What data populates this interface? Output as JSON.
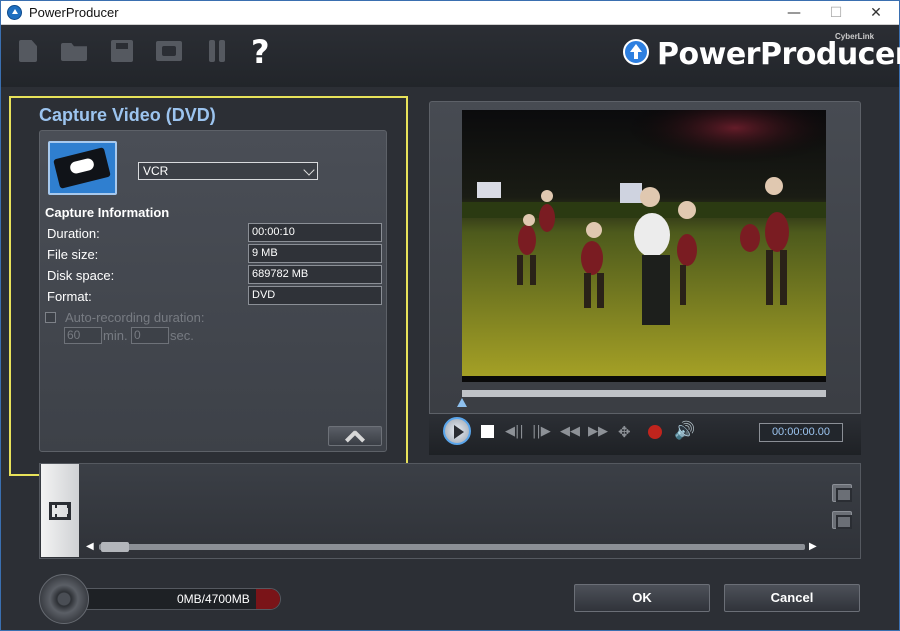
{
  "window": {
    "title": "PowerProducer"
  },
  "toolbar": {
    "items": [
      {
        "name": "new-project-icon"
      },
      {
        "name": "open-project-icon"
      },
      {
        "name": "save-project-icon"
      },
      {
        "name": "burn-icon"
      },
      {
        "name": "tools-icon"
      },
      {
        "name": "help-icon"
      }
    ],
    "help_glyph": "?"
  },
  "logo": {
    "brand": "CyberLink",
    "product": "PowerProducer"
  },
  "capture": {
    "title": "Capture Video (DVD)",
    "source": "VCR",
    "info_heading": "Capture Information",
    "fields": [
      {
        "label": "Duration:",
        "value": "00:00:10"
      },
      {
        "label": "File size:",
        "value": "9 MB"
      },
      {
        "label": "Disk space:",
        "value": "689782 MB"
      },
      {
        "label": "Format:",
        "value": "DVD"
      }
    ],
    "auto_recording_label": "Auto-recording duration:",
    "auto_recording_checked": false,
    "duration_min": "60",
    "duration_min_unit": "min.",
    "duration_sec": "0",
    "duration_sec_unit": "sec."
  },
  "player": {
    "timecode": "00:00:00.00",
    "seek_position": 0,
    "controls": {
      "prev_frame": "◀||",
      "next_frame": "||▶",
      "rewind": "◀◀",
      "fast_forward": "▶▶",
      "snapshot": "✥",
      "volume": "🔊"
    }
  },
  "storyboard": {
    "left_arrow": "◀",
    "right_arrow": "▶"
  },
  "disc": {
    "usage": "0MB/4700MB"
  },
  "buttons": {
    "ok": "OK",
    "cancel": "Cancel"
  },
  "colors": {
    "accent": "#9cc4ef",
    "highlight_frame": "#e8e25a",
    "record": "#c0241d",
    "capacity_fill": "#7a1418"
  }
}
